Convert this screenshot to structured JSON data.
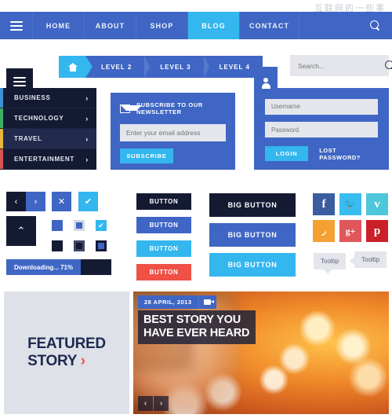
{
  "watermark": "互联网的一些事",
  "topnav": {
    "menu_icon": "hamburger-icon",
    "items": [
      {
        "label": "HOME",
        "active": false
      },
      {
        "label": "ABOUT",
        "active": false
      },
      {
        "label": "SHOP",
        "active": false
      },
      {
        "label": "BLOG",
        "active": true
      },
      {
        "label": "CONTACT",
        "active": false
      }
    ],
    "search_icon": "search-icon"
  },
  "breadcrumb": {
    "home_icon": "home-icon",
    "levels": [
      "LEVEL 2",
      "LEVEL 3",
      "LEVEL 4"
    ]
  },
  "sidebar": {
    "toggle_icon": "hamburger-icon",
    "items": [
      {
        "label": "BUSINESS",
        "accent": "#3f8fd6",
        "active": false,
        "chevron": "›"
      },
      {
        "label": "TECHNOLOGY",
        "accent": "#3fae63",
        "active": false,
        "chevron": "›"
      },
      {
        "label": "TRAVEL",
        "accent": "#e8b63c",
        "active": true,
        "chevron": "›"
      },
      {
        "label": "ENTERTAINMENT",
        "accent": "#d9534f",
        "active": false,
        "chevron": "›"
      }
    ]
  },
  "newsletter": {
    "icon": "envelope-icon",
    "title": "SUBSCRIBE TO OUR NEWSLETTER",
    "input_placeholder": "Enter your email address",
    "input_value": "",
    "button_label": "SUBSCRIBE"
  },
  "search": {
    "placeholder": "Search...",
    "value": "",
    "icon": "search-icon"
  },
  "login": {
    "tab_icon": "user-icon",
    "username_placeholder": "Username",
    "username_value": "",
    "password_placeholder": "Password",
    "password_value": "",
    "login_label": "LOGIN",
    "lost_label": "LOST PASSWORD?"
  },
  "controls": {
    "prev_icon": "chevron-left-icon",
    "next_icon": "chevron-right-icon",
    "up_icon": "chevron-up-icon",
    "close_icon": "close-icon",
    "check_icon": "check-icon",
    "prev_glyph": "‹",
    "next_glyph": "›",
    "up_glyph": "⌃",
    "close_glyph": "✕",
    "check_glyph": "✔",
    "progress": {
      "label": "Downloading... 71%",
      "percent": 71
    }
  },
  "buttons": {
    "small": [
      {
        "label": "BUTTON",
        "color": "#151a33"
      },
      {
        "label": "BUTTON",
        "color": "#3f66c4"
      },
      {
        "label": "BUTTON",
        "color": "#34b6ef"
      },
      {
        "label": "BUTTON",
        "color": "#ef5145"
      }
    ],
    "big": [
      {
        "label": "BIG BUTTON",
        "color": "#151a33"
      },
      {
        "label": "BIG BUTTON",
        "color": "#3f66c4"
      },
      {
        "label": "BIG BUTTON",
        "color": "#34b6ef"
      }
    ]
  },
  "social": [
    {
      "name": "facebook-icon",
      "glyph": "f",
      "color": "#3b5da0"
    },
    {
      "name": "twitter-icon",
      "glyph": "🐦",
      "color": "#38bdf0"
    },
    {
      "name": "vimeo-icon",
      "glyph": "v",
      "color": "#4dc7d9"
    },
    {
      "name": "rss-icon",
      "glyph": "◞",
      "color": "#f5a033"
    },
    {
      "name": "google-plus-icon",
      "glyph": "g+",
      "color": "#e0575b"
    },
    {
      "name": "pinterest-icon",
      "glyph": "p",
      "color": "#cb2027"
    }
  ],
  "tooltips": [
    {
      "label": "Tooltip",
      "pointer": "bottom"
    },
    {
      "label": "Tooltip",
      "pointer": "left"
    }
  ],
  "featured": {
    "line1": "FEATURED",
    "line2": "STORY",
    "arrow": "›"
  },
  "story": {
    "date": "28 APRIL, 2013",
    "media_icon": "video-camera-icon",
    "headline_line1": "BEST STORY YOU",
    "headline_line2": "HAVE EVER HEARD",
    "prev_glyph": "‹",
    "next_glyph": "›"
  },
  "colors": {
    "primary_blue": "#3f66c4",
    "accent_cyan": "#34b6ef",
    "dark_navy": "#151a33",
    "red": "#ef5145",
    "light_grey": "#e4e6ec"
  }
}
